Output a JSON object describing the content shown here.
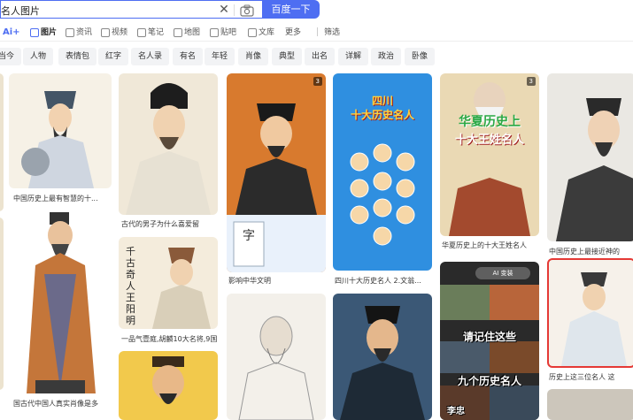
{
  "search": {
    "query": "名人图片",
    "button_label": "百度一下"
  },
  "tabs": [
    {
      "label": "Ai+",
      "icon": "ai-icon"
    },
    {
      "label": "图片",
      "icon": "image-icon",
      "active": true
    },
    {
      "label": "资讯",
      "icon": "news-icon"
    },
    {
      "label": "视频",
      "icon": "video-icon"
    },
    {
      "label": "笔记",
      "icon": "note-icon"
    },
    {
      "label": "地图",
      "icon": "map-icon"
    },
    {
      "label": "贴吧",
      "icon": "tieba-icon"
    },
    {
      "label": "文库",
      "icon": "doc-icon"
    },
    {
      "label": "更多",
      "icon": ""
    },
    {
      "label": "筛选",
      "icon": "filter-icon"
    }
  ],
  "filters": [
    "当今",
    "人物",
    "表情包",
    "红字",
    "名人录",
    "有名",
    "年轻",
    "肖像",
    "典型",
    "出名",
    "详解",
    "政治",
    "卧像"
  ],
  "results": {
    "col1": [
      {
        "caption": ""
      },
      {
        "caption": "国古代中国人真实肖像是多"
      }
    ],
    "col2": [
      {
        "caption": "中国历史上最有智慧的十..."
      },
      {
        "caption": ""
      },
      {
        "caption": ""
      }
    ],
    "col3": [
      {
        "caption": "古代的男子为什么喜爱留"
      },
      {
        "caption": "一品气壹庭,胡麟10大名将,9国...",
        "calligraphy": "千古奇人 王阳明"
      },
      {
        "caption": ""
      }
    ],
    "col4": [
      {
        "caption": "影响中华文明",
        "badge": "3"
      },
      {
        "caption": ""
      }
    ],
    "col5": [
      {
        "caption": "四川十大历史名人 2.文翁...",
        "poster_line1": "四川",
        "poster_line2": "十大历史名人"
      },
      {
        "caption": ""
      }
    ],
    "col6": [
      {
        "caption": "华夏历史上的十大王姓名人",
        "badge": "3",
        "poster_line1": "华夏历史上",
        "poster_line2": "十大王姓名人"
      },
      {
        "caption": "",
        "ai_label": "AI 变装",
        "meme_line1": "请记住这些",
        "meme_line2": "九个历史名人",
        "meme_name": "李忠"
      }
    ],
    "col7": [
      {
        "caption": "中国历史上最接近神的"
      },
      {
        "caption": "历史上这三位名人 这"
      }
    ]
  },
  "colors": {
    "accent": "#4e6ef2",
    "chip_bg": "#f2f3f5",
    "selected_border": "#e53935"
  }
}
